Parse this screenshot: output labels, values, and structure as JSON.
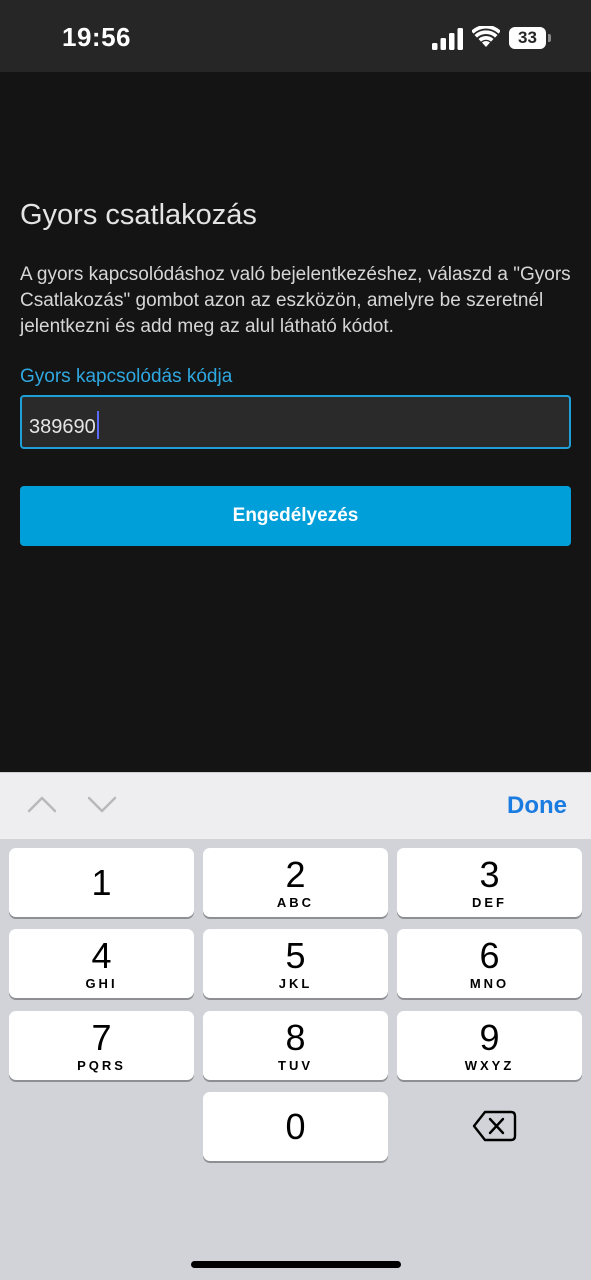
{
  "status_bar": {
    "time": "19:56",
    "battery_level": "33",
    "icons": [
      "cellular-signal-icon",
      "wifi-icon",
      "battery-icon"
    ]
  },
  "page": {
    "title": "Gyors csatlakozás",
    "description": "A gyors kapcsolódáshoz való bejelentkezéshez, válaszd a \"Gyors Csatlakozás\" gombot azon az eszközön, amelyre be szeretnél jelentkezni és add meg az alul látható kódot.",
    "code_field_label": "Gyors kapcsolódás kódja",
    "code_value": "389690",
    "approve_button_label": "Engedélyezés"
  },
  "keyboard": {
    "toolbar_icons": [
      "chevron-up-icon",
      "chevron-down-icon"
    ],
    "done_label": "Done",
    "keys": [
      {
        "digit": "1",
        "letters": ""
      },
      {
        "digit": "2",
        "letters": "ABC"
      },
      {
        "digit": "3",
        "letters": "DEF"
      },
      {
        "digit": "4",
        "letters": "GHI"
      },
      {
        "digit": "5",
        "letters": "JKL"
      },
      {
        "digit": "6",
        "letters": "MNO"
      },
      {
        "digit": "7",
        "letters": "PQRS"
      },
      {
        "digit": "8",
        "letters": "TUV"
      },
      {
        "digit": "9",
        "letters": "WXYZ"
      },
      {
        "digit": "0",
        "letters": ""
      }
    ],
    "delete_icon": "backspace-icon"
  },
  "colors": {
    "background": "#141414",
    "status_bar": "#262626",
    "accent": "#009fd9",
    "field_border": "#1e9fd8",
    "label_blue": "#2fa8e0",
    "done_blue": "#1a7be0",
    "keypad_bg": "#d1d3d8"
  }
}
